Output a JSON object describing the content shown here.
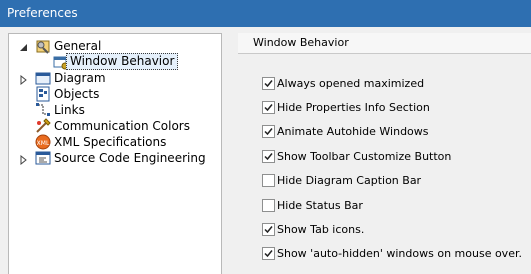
{
  "window": {
    "title": "Preferences"
  },
  "tree": {
    "items": [
      {
        "label": "General",
        "icon": "general-settings-icon",
        "expanded": true
      },
      {
        "label": "Window Behavior",
        "icon": "window-behavior-icon",
        "selected": true
      },
      {
        "label": "Diagram",
        "icon": "diagram-icon",
        "expanded": false
      },
      {
        "label": "Objects",
        "icon": "objects-icon"
      },
      {
        "label": "Links",
        "icon": "links-icon"
      },
      {
        "label": "Communication Colors",
        "icon": "palette-icon"
      },
      {
        "label": "XML Specifications",
        "icon": "xml-icon"
      },
      {
        "label": "Source Code Engineering",
        "icon": "source-code-icon",
        "expanded": false
      }
    ]
  },
  "section": {
    "title": "Window Behavior"
  },
  "options": [
    {
      "label": "Always opened maximized",
      "checked": true
    },
    {
      "label": "Hide Properties Info Section",
      "checked": true
    },
    {
      "label": "Animate Autohide Windows",
      "checked": true
    },
    {
      "label": "Show Toolbar Customize Button",
      "checked": true
    },
    {
      "label": "Hide Diagram Caption Bar",
      "checked": false
    },
    {
      "label": "Hide Status Bar",
      "checked": false
    },
    {
      "label": "Show Tab icons.",
      "checked": true
    },
    {
      "label": "Show 'auto-hidden' windows on mouse over.",
      "checked": true
    }
  ],
  "colors": {
    "titlebar": "#2e6fb1",
    "selection": "#e5f0fb"
  }
}
